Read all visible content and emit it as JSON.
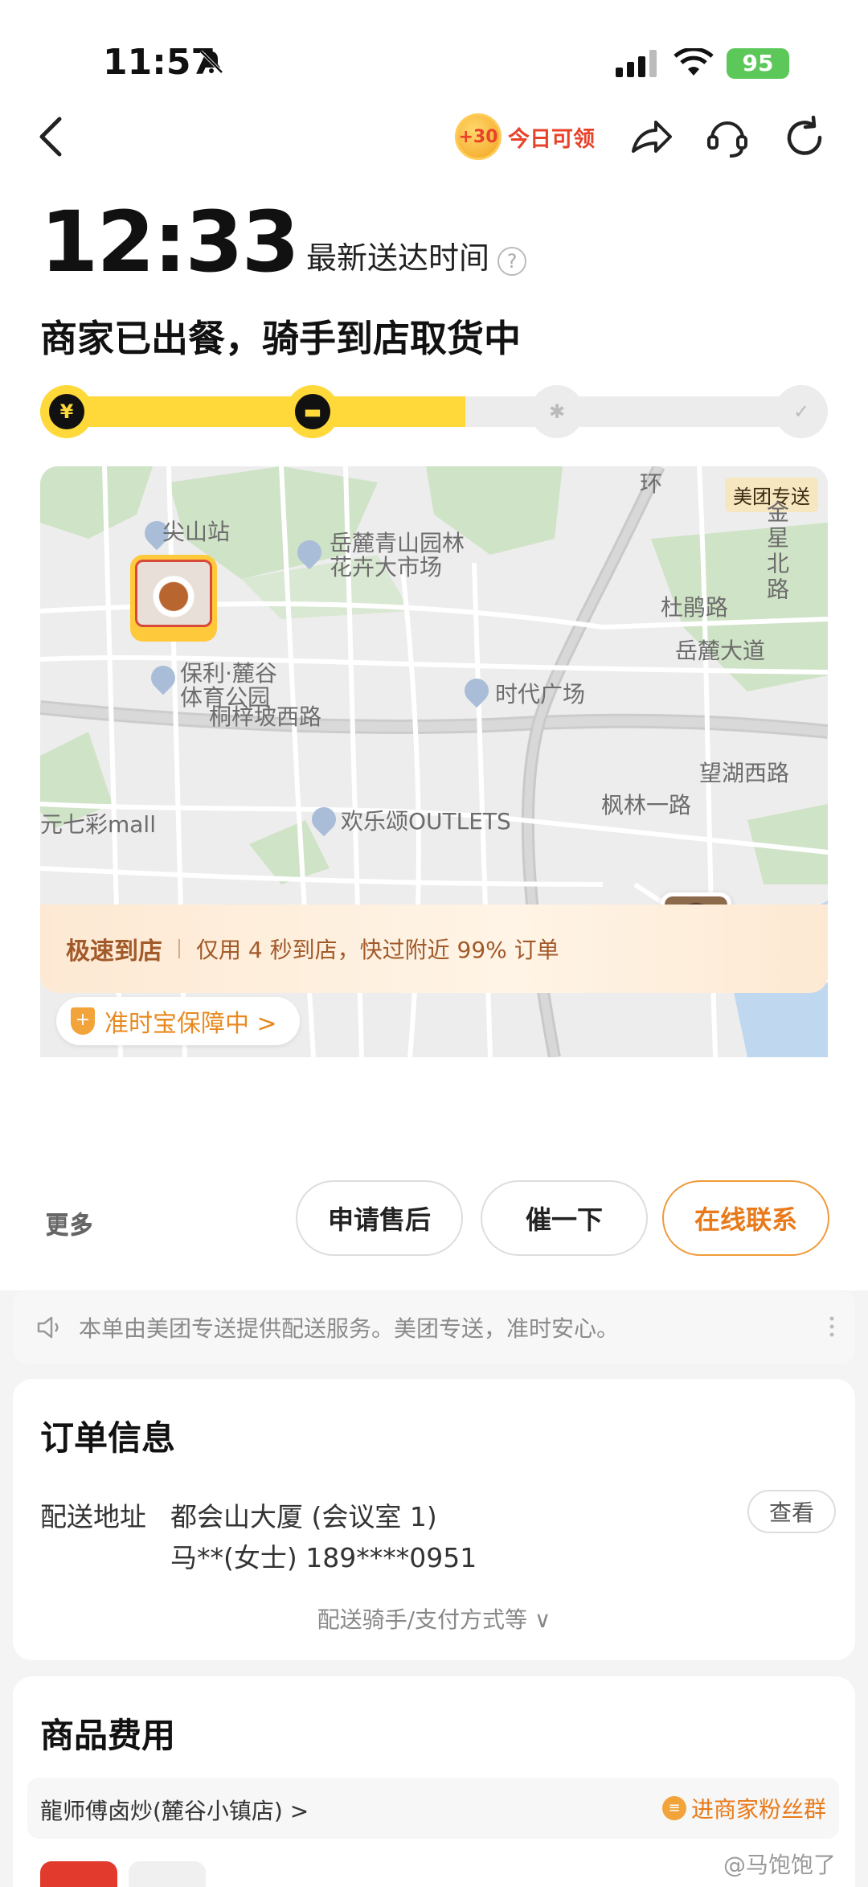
{
  "status_bar": {
    "time": "11:57",
    "battery": "95"
  },
  "header": {
    "promo_coin": "+30",
    "promo_text": "今日可领"
  },
  "eta": {
    "time": "12:33",
    "label": "最新送达时间",
    "help": "?"
  },
  "order_status": "商家已出餐，骑手到店取货中",
  "progress": {
    "completed_fraction": 0.54,
    "steps": [
      {
        "state": "done",
        "glyph": "¥"
      },
      {
        "state": "done",
        "glyph": "▬"
      },
      {
        "state": "todo",
        "glyph": "✱"
      },
      {
        "state": "todo",
        "glyph": "✓"
      }
    ]
  },
  "map": {
    "service_badge": "美团专送",
    "labels": {
      "jianshan": "尖山站",
      "yuelu_line1": "岳麓青山园林",
      "yuelu_line2": "花卉大市场",
      "jinxing": "金星北路",
      "huan": "环",
      "dujuan": "杜鹃路",
      "yuelu_avenue": "岳麓大道",
      "poly_line1": "保利·麓谷",
      "poly_line2": "体育公园",
      "shidai": "时代广场",
      "tongzipo": "桐梓坡西路",
      "wanjia": "望湖西路",
      "fenglin": "枫林一路",
      "huanle": "欢乐颂OUTLETS",
      "qicai": "元七彩mall"
    },
    "guarantee": "准时宝保障中 >"
  },
  "speed_banner": {
    "title": "极速到店",
    "desc": "仅用 4 秒到店，快过附近 99% 订单"
  },
  "actions": {
    "more": "更多",
    "after_sale": "申请售后",
    "urge": "催一下",
    "contact": "在线联系"
  },
  "notice": "本单由美团专送提供配送服务。美团专送，准时安心。",
  "order_info": {
    "title": "订单信息",
    "address_label": "配送地址",
    "address": "都会山大厦 (会议室 1)",
    "contact": "马**(女士) 189****0951",
    "view": "查看",
    "more": "配送骑手/支付方式等 ∨"
  },
  "goods": {
    "title": "商品费用",
    "shop_name": "龍师傅卤炒(麓谷小镇店) >",
    "fans": "进商家粉丝群"
  },
  "watermark": "@马饱饱了"
}
